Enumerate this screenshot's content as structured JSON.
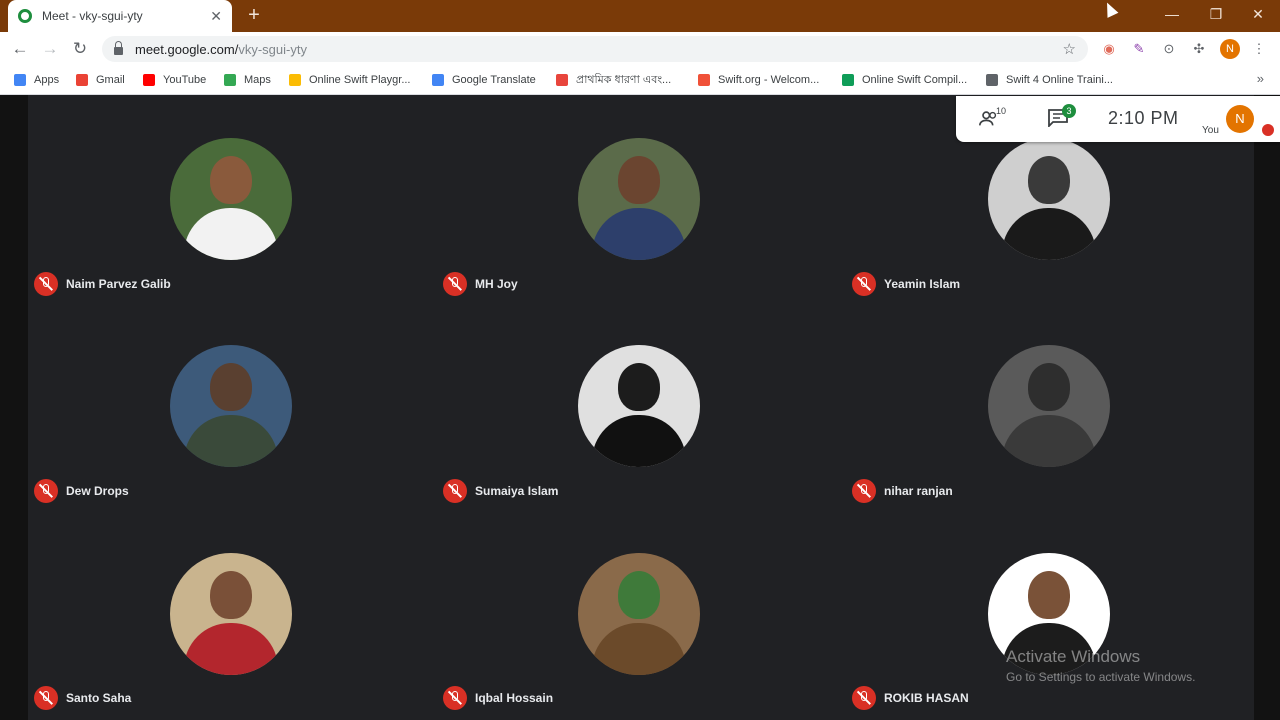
{
  "browser": {
    "tab_title": "Meet - vky-sgui-yty",
    "url_host": "meet.google.com/",
    "url_path": "vky-sgui-yty",
    "profile_initial": "N"
  },
  "bookmarks": [
    {
      "label": "Apps",
      "color": "#4285f4"
    },
    {
      "label": "Gmail",
      "color": "#ea4335"
    },
    {
      "label": "YouTube",
      "color": "#ff0000"
    },
    {
      "label": "Maps",
      "color": "#34a853"
    },
    {
      "label": "Online Swift Playgr...",
      "color": "#fbbc04"
    },
    {
      "label": "Google Translate",
      "color": "#4285f4"
    },
    {
      "label": "প্রাথমিক ধারণা এবং...",
      "color": "#e8453c"
    },
    {
      "label": "Swift.org - Welcom...",
      "color": "#f05138"
    },
    {
      "label": "Online Swift Compil...",
      "color": "#0f9d58"
    },
    {
      "label": "Swift 4 Online Traini...",
      "color": "#5f6368"
    }
  ],
  "meeting": {
    "participant_count": "10",
    "chat_count": "3",
    "time": "2:10  PM",
    "you_label": "You",
    "you_initial": "N",
    "participants": [
      {
        "name": "Naim Parvez Galib",
        "bg": "#4a6b3a",
        "skin": "#8a5a3c",
        "shirt": "#f2f2f2"
      },
      {
        "name": "MH Joy",
        "bg": "#5b6b4a",
        "skin": "#6b4530",
        "shirt": "#2d3f6b"
      },
      {
        "name": "Yeamin Islam",
        "bg": "#cfcfcf",
        "skin": "#3a3a3a",
        "shirt": "#1a1a1a"
      },
      {
        "name": "Dew Drops",
        "bg": "#3d5a7a",
        "skin": "#5a4030",
        "shirt": "#3a4a3a"
      },
      {
        "name": "Sumaiya Islam",
        "bg": "#e0e0e0",
        "skin": "#1c1c1c",
        "shirt": "#111111"
      },
      {
        "name": "nihar ranjan",
        "bg": "#5a5a5a",
        "skin": "#2e2e2e",
        "shirt": "#3a3a3a"
      },
      {
        "name": "Santo Saha",
        "bg": "#c9b48e",
        "skin": "#7a5038",
        "shirt": "#b3262d"
      },
      {
        "name": "Iqbal Hossain",
        "bg": "#8a6a4a",
        "skin": "#3f7a3a",
        "shirt": "#6b4a2a"
      },
      {
        "name": "ROKIB HASAN",
        "bg": "#ffffff",
        "skin": "#7a5238",
        "shirt": "#1c1c1c"
      }
    ]
  },
  "watermark": {
    "line1": "Activate Windows",
    "line2": "Go to Settings to activate Windows."
  }
}
